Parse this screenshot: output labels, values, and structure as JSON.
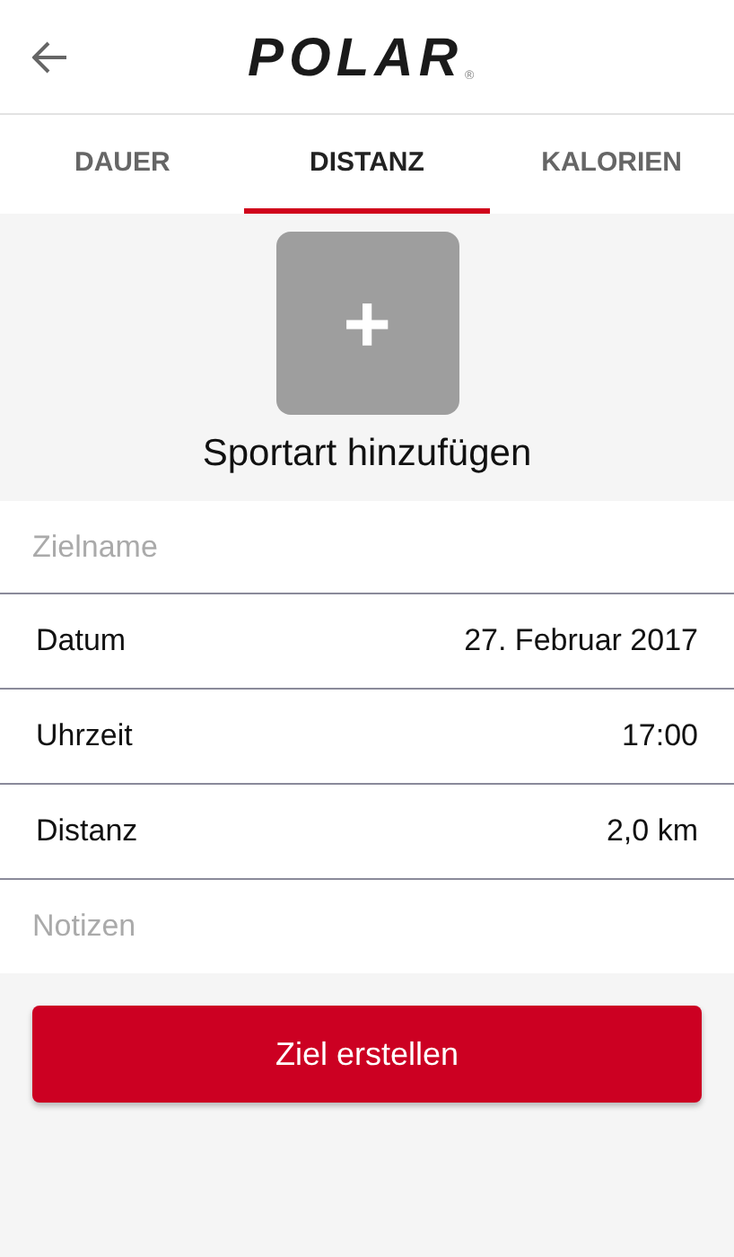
{
  "header": {
    "logo": "POLAR",
    "logo_mark": "®"
  },
  "tabs": [
    {
      "label": "DAUER",
      "selected": false
    },
    {
      "label": "DISTANZ",
      "selected": true
    },
    {
      "label": "KALORIEN",
      "selected": false
    }
  ],
  "sport": {
    "add_symbol": "+",
    "label": "Sportart hinzufügen"
  },
  "name_field": {
    "placeholder": "Zielname"
  },
  "rows": [
    {
      "label": "Datum",
      "value": "27. Februar 2017"
    },
    {
      "label": "Uhrzeit",
      "value": "17:00"
    },
    {
      "label": "Distanz",
      "value": "2,0 km"
    }
  ],
  "notes_field": {
    "placeholder": "Notizen"
  },
  "button": "Ziel erstellen"
}
